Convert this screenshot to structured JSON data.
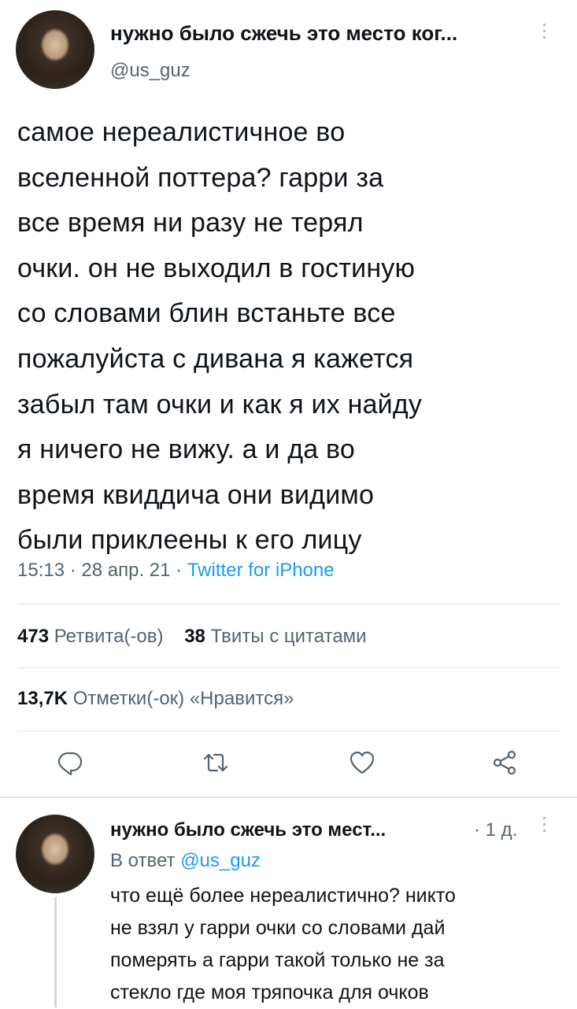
{
  "tweet": {
    "author_name": "нужно было сжечь это место ког...",
    "handle": "@us_guz",
    "text": "самое нереалистичное во\nвселенной поттера? гарри за\nвсе время ни разу не терял\nочки. он не выходил в гостиную\nсо словами блин встаньте все\nпожалуйста с дивана я кажется\nзабыл там очки и как я их найду\nя ничего не вижу. а и да во\nвремя квиддича они видимо\nбыли приклеены к его лицу",
    "time": "15:13",
    "date": "28 апр. 21",
    "separator": "·",
    "source": "Twitter for iPhone",
    "stats": {
      "retweets_count": "473",
      "retweets_label": "Ретвита(-ов)",
      "quotes_count": "38",
      "quotes_label": "Твиты с цитатами",
      "likes_count": "13,7K",
      "likes_label": "Отметки(-ок) «Нравится»"
    },
    "actions": [
      "reply-icon",
      "retweet-icon",
      "like-icon",
      "share-icon"
    ]
  },
  "reply": {
    "author_name": "нужно было сжечь это мест...",
    "time": "· 1 д.",
    "reply_prefix": "В ответ",
    "reply_to_handle": "@us_guz",
    "text": "что ещё более нереалистично? никто\nне взял у гарри очки со словами дай\nпомерять а гарри такой только не за\nстекло где моя тряпочка для очков"
  },
  "colors": {
    "text": "#0f1419",
    "secondary": "#536471",
    "link": "#1d9bf0",
    "divider": "#e3e7ea"
  }
}
